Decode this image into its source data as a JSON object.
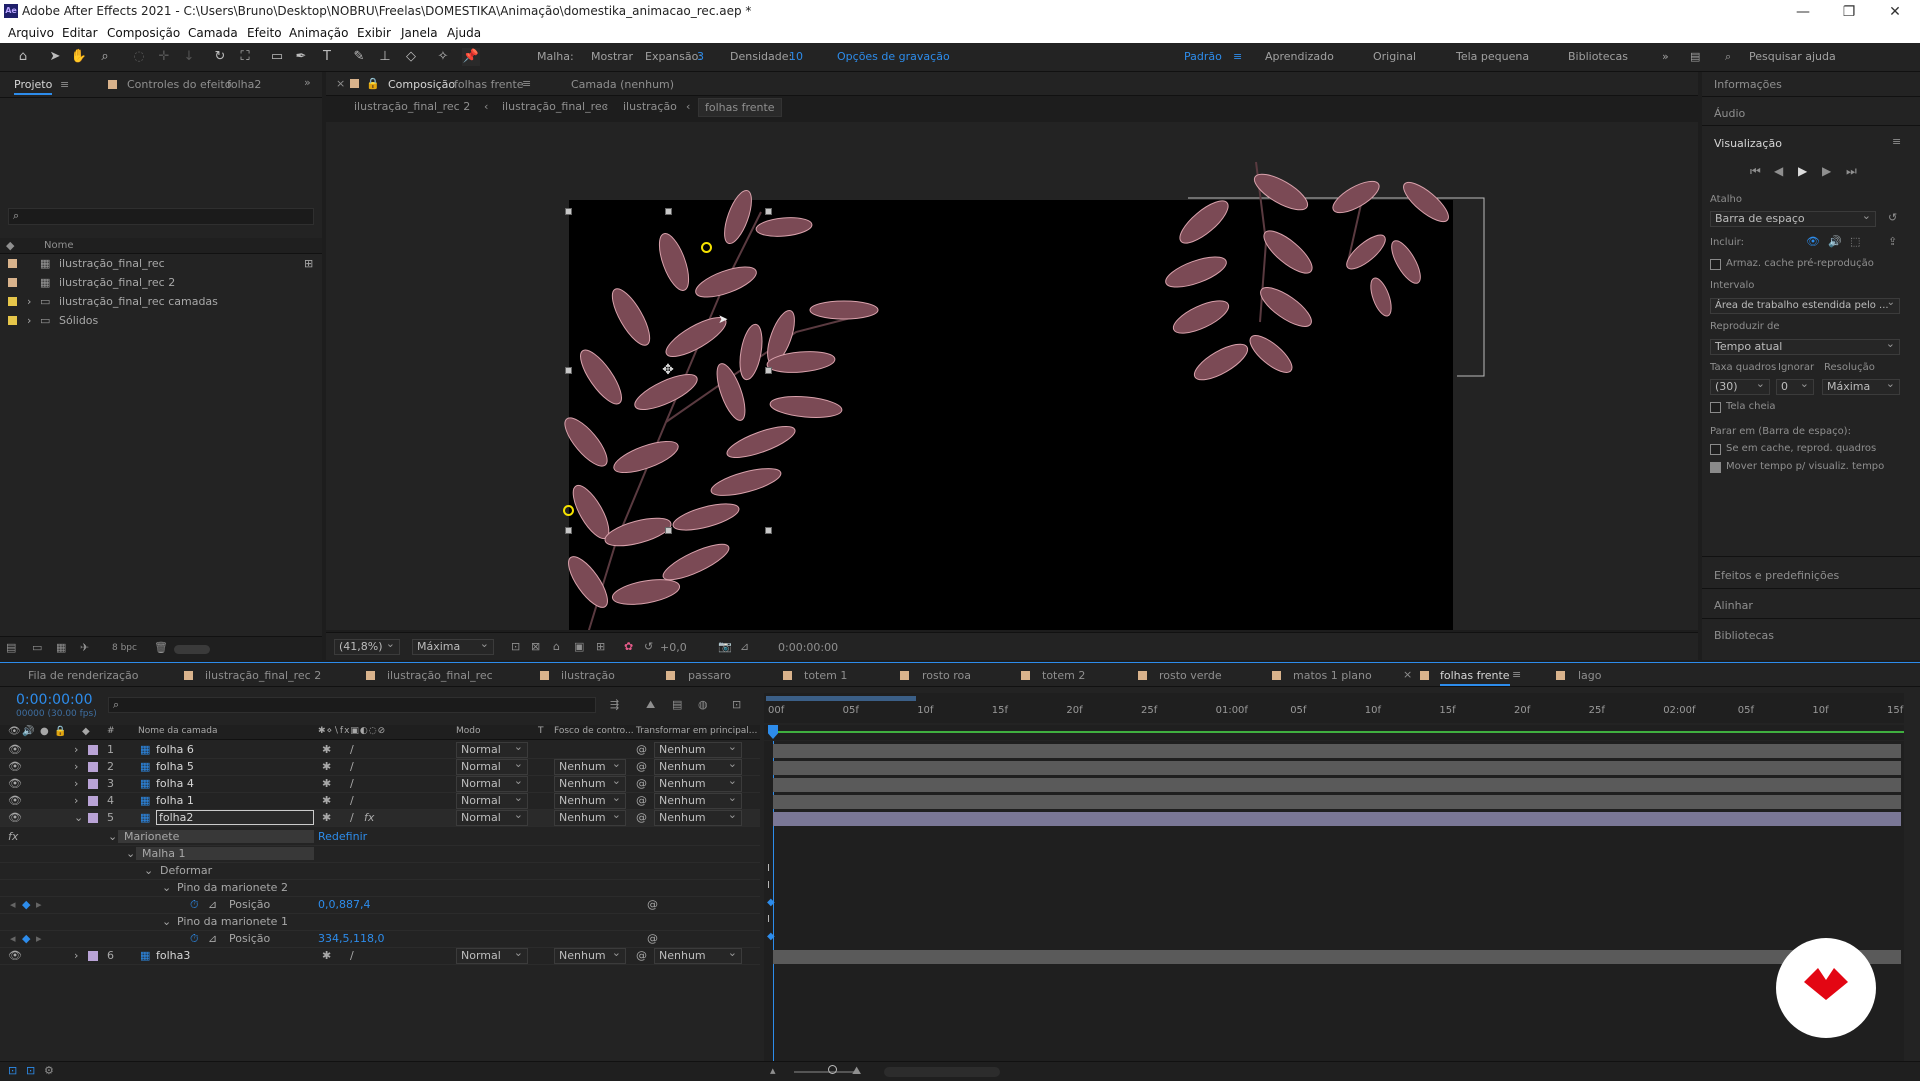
{
  "window": {
    "title": "Adobe After Effects 2021 - C:\\Users\\Bruno\\Desktop\\NOBRU\\Freelas\\DOMESTIKA\\Animação\\domestika_animacao_rec.aep *",
    "app_icon": "Ae"
  },
  "menu": [
    "Arquivo",
    "Editar",
    "Composição",
    "Camada",
    "Efeito",
    "Animação",
    "Exibir",
    "Janela",
    "Ajuda"
  ],
  "toolbar": {
    "malha_label": "Malha:",
    "mostrar_label": "Mostrar",
    "expansao_label": "Expansão:",
    "expansao_value": "3",
    "densidade_label": "Densidade:",
    "densidade_value": "10",
    "opcoes_label": "Opções de gravação",
    "workspaces": [
      "Padrão",
      "Aprendizado",
      "Original",
      "Tela pequena",
      "Bibliotecas"
    ],
    "search_placeholder": "Pesquisar ajuda"
  },
  "project": {
    "tab": "Projeto",
    "effect_controls_label": "Controles do efeito",
    "effect_controls_layer": "folha2",
    "col_name": "Nome",
    "items": [
      {
        "name": "ilustração_final_rec",
        "type": "comp",
        "color": "#d9b38c"
      },
      {
        "name": "ilustração_final_rec 2",
        "type": "comp",
        "color": "#d9b38c"
      },
      {
        "name": "ilustração_final_rec camadas",
        "type": "folder",
        "color": "#e6c64a"
      },
      {
        "name": "Sólidos",
        "type": "folder",
        "color": "#e6c64a"
      }
    ],
    "bpc": "8 bpc"
  },
  "composition": {
    "tab_prefix": "Composição",
    "tab_name": "folhas frente",
    "layer_tab": "Camada (nenhum)",
    "breadcrumbs": [
      "ilustração_final_rec 2",
      "ilustração_final_rec",
      "ilustração",
      "folhas frente"
    ],
    "zoom": "(41,8%)",
    "resolution": "Máxima",
    "exposure": "+0,0",
    "timecode": "0:00:00:00"
  },
  "right_panel": {
    "info": "Informações",
    "audio": "Áudio",
    "preview": "Visualização",
    "atalho_label": "Atalho",
    "atalho_value": "Barra de espaço",
    "incluir_label": "Incluir:",
    "cache_label": "Armaz. cache pré-reprodução",
    "intervalo_label": "Intervalo",
    "intervalo_value": "Área de trabalho estendida pelo ...",
    "reproduzir_label": "Reproduzir de",
    "reproduzir_value": "Tempo atual",
    "taxa_label": "Taxa quadros",
    "ignorar_label": "Ignorar",
    "resolucao_label": "Resolução",
    "taxa_value": "(30)",
    "ignorar_value": "0",
    "resolucao_value": "Máxima",
    "tela_cheia": "Tela cheia",
    "parar_label": "Parar em (Barra de espaço):",
    "se_cache": "Se em cache, reprod. quadros",
    "mover_tempo": "Mover tempo p/ visualiz. tempo",
    "mover_tempo_checked": true,
    "efeitos": "Efeitos e predefinições",
    "alinhar": "Alinhar",
    "bibliotecas": "Bibliotecas"
  },
  "timeline_tabs": [
    "Fila de renderização",
    "ilustração_final_rec 2",
    "ilustração_final_rec",
    "ilustração",
    "passaro",
    "totem 1",
    "rosto roa",
    "totem 2",
    "rosto verde",
    "matos 1 plano",
    "folhas frente",
    "lago"
  ],
  "timeline": {
    "timecode": "0:00:00:00",
    "fps": "00000 (30.00 fps)",
    "headers": {
      "num": "#",
      "name": "Nome da camada",
      "mode": "Modo",
      "t": "T",
      "track": "Fosco de contro...",
      "parent": "Transformar em principal..."
    },
    "ruler": [
      "00f",
      "05f",
      "10f",
      "15f",
      "20f",
      "25f",
      "01:00f",
      "05f",
      "10f",
      "15f",
      "20f",
      "25f",
      "02:00f",
      "05f",
      "10f",
      "15f"
    ],
    "layers": [
      {
        "num": "1",
        "name": "folha 6",
        "mode": "Normal",
        "track": "",
        "parent": "Nenhum"
      },
      {
        "num": "2",
        "name": "folha 5",
        "mode": "Normal",
        "track": "Nenhum",
        "parent": "Nenhum"
      },
      {
        "num": "3",
        "name": "folha 4",
        "mode": "Normal",
        "track": "Nenhum",
        "parent": "Nenhum"
      },
      {
        "num": "4",
        "name": "folha 1",
        "mode": "Normal",
        "track": "Nenhum",
        "parent": "Nenhum"
      },
      {
        "num": "5",
        "name": "folha2",
        "mode": "Normal",
        "track": "Nenhum",
        "parent": "Nenhum"
      }
    ],
    "props": {
      "marionete": "Marionete",
      "redefinir": "Redefinir",
      "malha1": "Malha 1",
      "deformar": "Deformar",
      "pino2": "Pino da marionete 2",
      "posicao": "Posição",
      "pino2_value": "0,0,887,4",
      "pino1": "Pino da marionete 1",
      "pino1_value": "334,5,118,0"
    },
    "layer6": {
      "num": "6",
      "name": "folha3",
      "mode": "Normal",
      "track": "Nenhum",
      "parent": "Nenhum"
    }
  },
  "colors": {
    "accent": "#2d8ceb",
    "leaf": "#7b4a55",
    "layer_label": "#b9a3d6",
    "logo": "#e30613"
  }
}
